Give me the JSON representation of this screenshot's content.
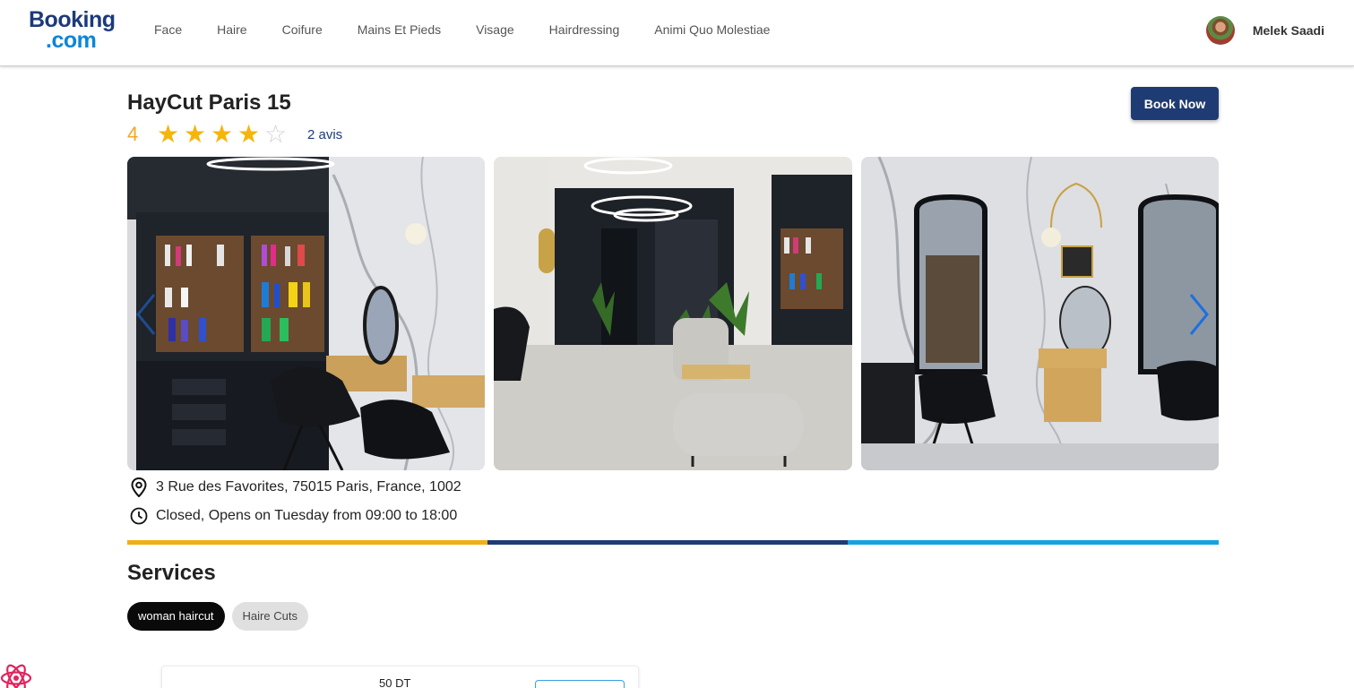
{
  "brand": {
    "line1": "Booking",
    "line2": ".com"
  },
  "nav": [
    "Face",
    "Haire",
    "Coifure",
    "Mains Et Pieds",
    "Visage",
    "Hairdressing",
    "Animi Quo Molestiae"
  ],
  "user": {
    "name": "Melek Saadi"
  },
  "salon": {
    "name": "HayCut Paris 15",
    "rating": 4,
    "rating_max": 5,
    "reviews_label": "2 avis",
    "address": "3 Rue des Favorites, 75015 Paris, France, 1002",
    "hours": "Closed, Opens on Tuesday from 09:00 to 18:00"
  },
  "actions": {
    "book_now": "Book Now"
  },
  "gallery": {
    "prev_icon": "chevron-left-icon",
    "next_icon": "chevron-right-icon"
  },
  "divider_colors": [
    "#f0b016",
    "#1f3b73",
    "#14a3e0"
  ],
  "services": {
    "title": "Services",
    "chips": [
      {
        "label": "woman haircut",
        "active": true
      },
      {
        "label": "Haire Cuts",
        "active": false
      }
    ]
  },
  "service_card": {
    "price": "50 DT"
  },
  "colors": {
    "brand_navy": "#1f3b73",
    "star": "#f5b50a",
    "accent_blue": "#1e6fe0"
  }
}
